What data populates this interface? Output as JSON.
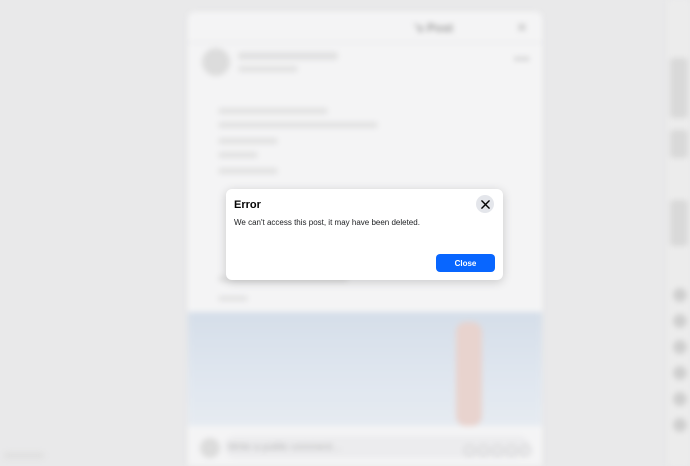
{
  "post_dialog": {
    "title": "'s Post",
    "close_icon": "close-icon",
    "more_icon": "more-options-icon",
    "comment_placeholder": "Write a public comment…"
  },
  "error_dialog": {
    "title": "Error",
    "message": "We can't access this post, it may have been deleted.",
    "close_icon": "close-icon",
    "close_button_label": "Close"
  },
  "colors": {
    "primary_button": "#0866ff",
    "close_icon_bg": "#e4e6eb",
    "overlay_bg": "#e9e9ea"
  }
}
